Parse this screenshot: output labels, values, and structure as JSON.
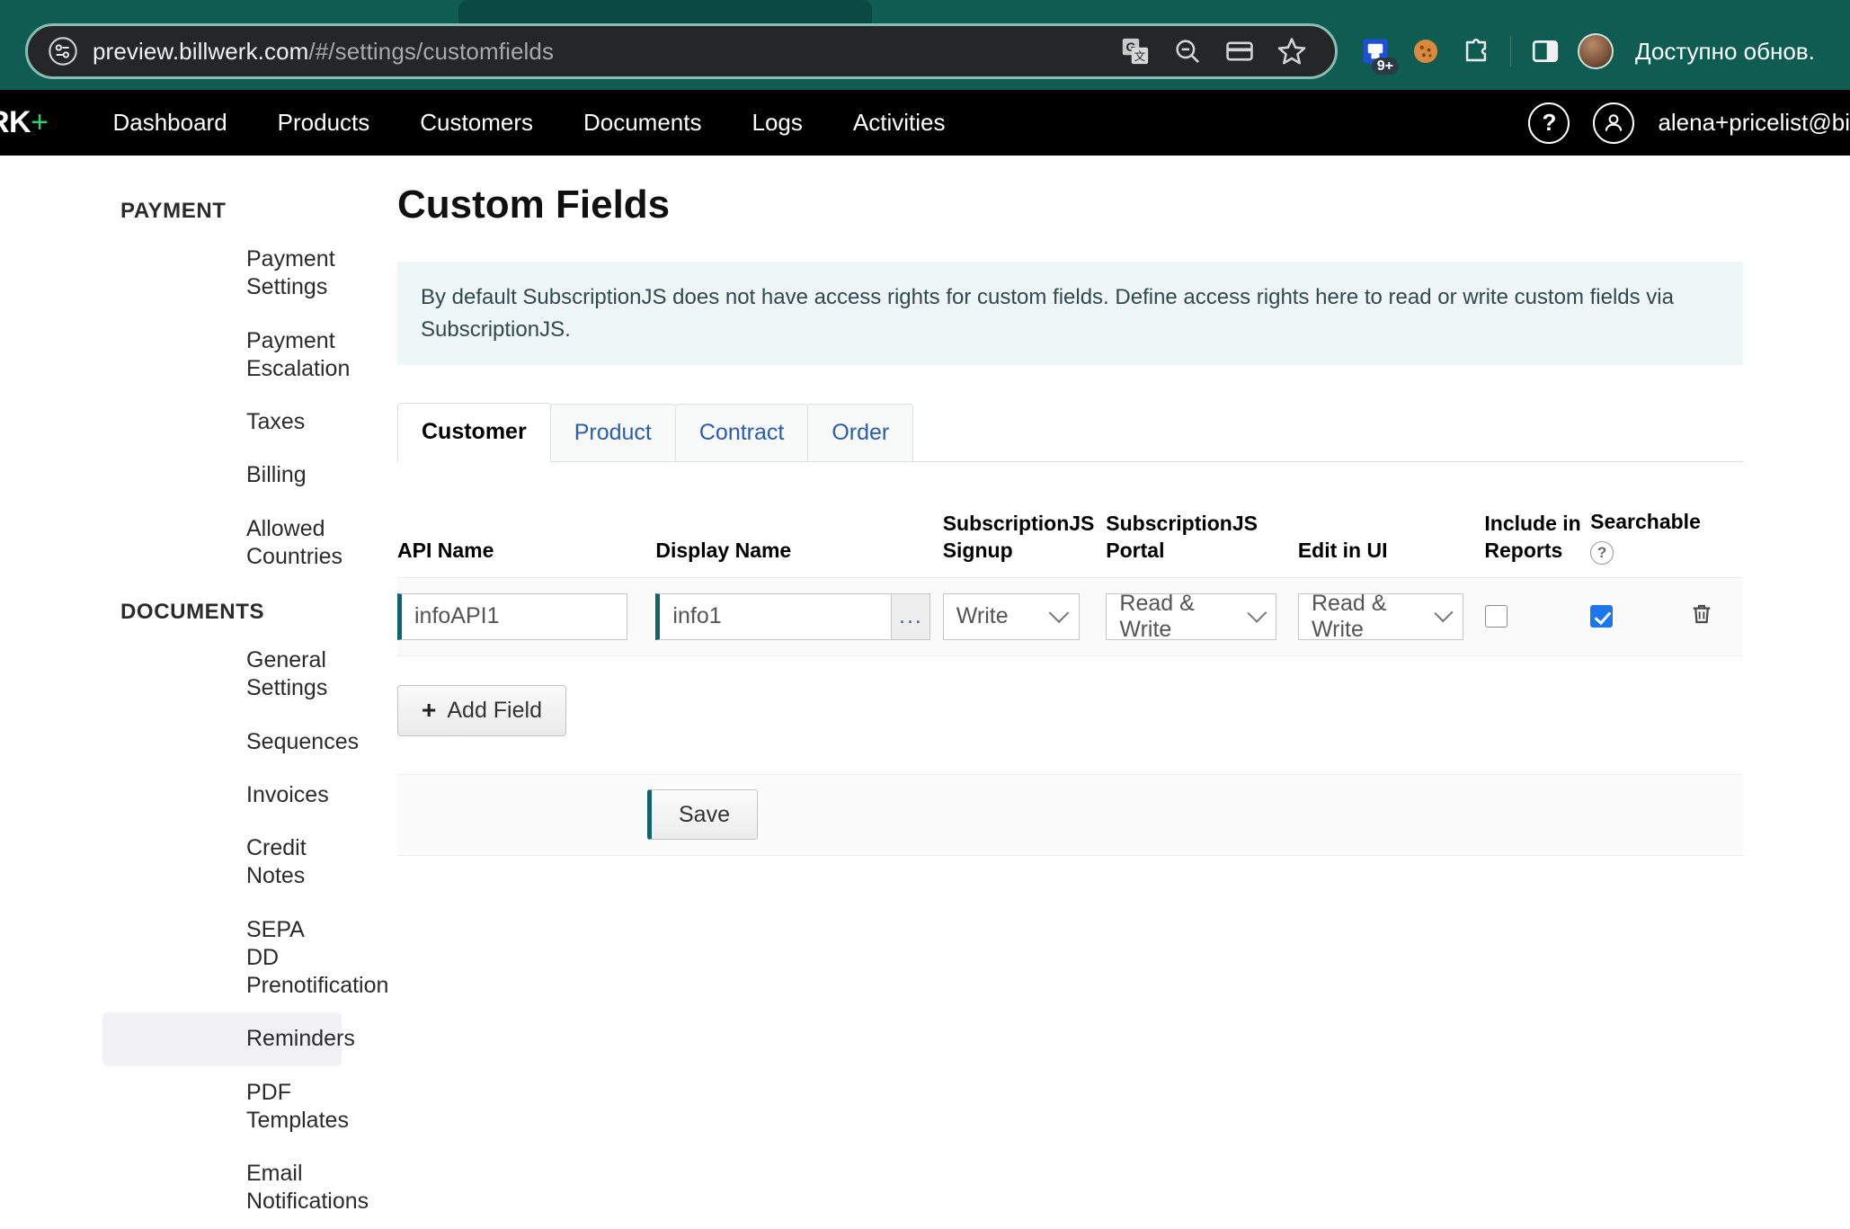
{
  "browser": {
    "url_host": "preview.billwerk.com",
    "url_path": "/#/settings/customfields",
    "omnibox_icons": [
      "site-info-icon",
      "translate-icon",
      "zoom-out-icon",
      "payment-card-icon",
      "bookmark-star-icon"
    ],
    "extension_badge": "9+",
    "update_notice": "Доступно обнов.",
    "right_icons": [
      "extension-saved-icon",
      "cookie-icon",
      "extensions-puzzle-icon",
      "side-panel-icon",
      "profile-avatar"
    ]
  },
  "app_nav": {
    "brand": "RK",
    "brand_plus": "+",
    "links": [
      "Dashboard",
      "Products",
      "Customers",
      "Documents",
      "Logs",
      "Activities"
    ],
    "help_icon": "?",
    "account_email": "alena+pricelist@bi"
  },
  "sidebar": {
    "groups": [
      {
        "title": "PAYMENT",
        "items": [
          {
            "label": "Payment Settings",
            "active": false
          },
          {
            "label": "Payment Escalation",
            "active": false
          },
          {
            "label": "Taxes",
            "active": false
          },
          {
            "label": "Billing",
            "active": false
          },
          {
            "label": "Allowed Countries",
            "active": false
          }
        ]
      },
      {
        "title": "DOCUMENTS",
        "items": [
          {
            "label": "General Settings",
            "active": false
          },
          {
            "label": "Sequences",
            "active": false
          },
          {
            "label": "Invoices",
            "active": false
          },
          {
            "label": "Credit Notes",
            "active": false
          },
          {
            "label": "SEPA DD Prenotification",
            "active": false
          },
          {
            "label": "Reminders",
            "active": true
          },
          {
            "label": "PDF Templates",
            "active": false
          },
          {
            "label": "Email Notifications",
            "active": false
          }
        ]
      }
    ]
  },
  "main": {
    "title": "Custom Fields",
    "info_banner": "By default SubscriptionJS does not have access rights for custom fields. Define access rights here to read or write custom fields via SubscriptionJS.",
    "tabs": [
      {
        "label": "Customer",
        "active": true
      },
      {
        "label": "Product",
        "active": false
      },
      {
        "label": "Contract",
        "active": false
      },
      {
        "label": "Order",
        "active": false
      }
    ],
    "table": {
      "headers": {
        "api_name": "API Name",
        "display_name": "Display Name",
        "subscriptionjs_signup_line1": "SubscriptionJS",
        "subscriptionjs_signup_line2": "Signup",
        "subscriptionjs_portal": "SubscriptionJS Portal",
        "edit_in_ui": "Edit in UI",
        "include_in_reports_line1": "Include in",
        "include_in_reports_line2": "Reports",
        "searchable": "Searchable",
        "searchable_help": "?"
      },
      "rows": [
        {
          "api_name": "infoAPI1",
          "display_name": "info1",
          "display_name_more": "...",
          "subscriptionjs_signup": "Write",
          "subscriptionjs_portal": "Read & Write",
          "edit_in_ui": "Read & Write",
          "include_in_reports": false,
          "searchable": true,
          "delete_icon": "trash-icon"
        }
      ]
    },
    "add_field_label": "Add Field",
    "add_field_icon": "+",
    "save_label": "Save"
  },
  "colors": {
    "browser_chrome": "#0f5c52",
    "app_nav": "#000000",
    "accent_teal": "#10626c",
    "banner_bg": "#eef6f8",
    "link_blue": "#2a5db0",
    "checkbox_blue": "#1b76ef"
  }
}
